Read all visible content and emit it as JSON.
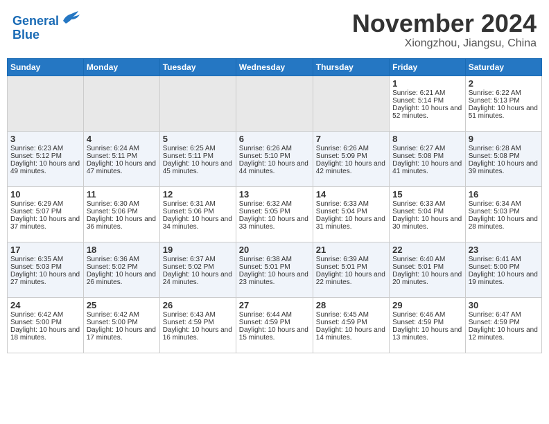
{
  "header": {
    "logo_line1": "General",
    "logo_line2": "Blue",
    "month_title": "November 2024",
    "location": "Xiongzhou, Jiangsu, China"
  },
  "weekdays": [
    "Sunday",
    "Monday",
    "Tuesday",
    "Wednesday",
    "Thursday",
    "Friday",
    "Saturday"
  ],
  "weeks": [
    [
      {
        "day": "",
        "sunrise": "",
        "sunset": "",
        "daylight": ""
      },
      {
        "day": "",
        "sunrise": "",
        "sunset": "",
        "daylight": ""
      },
      {
        "day": "",
        "sunrise": "",
        "sunset": "",
        "daylight": ""
      },
      {
        "day": "",
        "sunrise": "",
        "sunset": "",
        "daylight": ""
      },
      {
        "day": "",
        "sunrise": "",
        "sunset": "",
        "daylight": ""
      },
      {
        "day": "1",
        "sunrise": "Sunrise: 6:21 AM",
        "sunset": "Sunset: 5:14 PM",
        "daylight": "Daylight: 10 hours and 52 minutes."
      },
      {
        "day": "2",
        "sunrise": "Sunrise: 6:22 AM",
        "sunset": "Sunset: 5:13 PM",
        "daylight": "Daylight: 10 hours and 51 minutes."
      }
    ],
    [
      {
        "day": "3",
        "sunrise": "Sunrise: 6:23 AM",
        "sunset": "Sunset: 5:12 PM",
        "daylight": "Daylight: 10 hours and 49 minutes."
      },
      {
        "day": "4",
        "sunrise": "Sunrise: 6:24 AM",
        "sunset": "Sunset: 5:11 PM",
        "daylight": "Daylight: 10 hours and 47 minutes."
      },
      {
        "day": "5",
        "sunrise": "Sunrise: 6:25 AM",
        "sunset": "Sunset: 5:11 PM",
        "daylight": "Daylight: 10 hours and 45 minutes."
      },
      {
        "day": "6",
        "sunrise": "Sunrise: 6:26 AM",
        "sunset": "Sunset: 5:10 PM",
        "daylight": "Daylight: 10 hours and 44 minutes."
      },
      {
        "day": "7",
        "sunrise": "Sunrise: 6:26 AM",
        "sunset": "Sunset: 5:09 PM",
        "daylight": "Daylight: 10 hours and 42 minutes."
      },
      {
        "day": "8",
        "sunrise": "Sunrise: 6:27 AM",
        "sunset": "Sunset: 5:08 PM",
        "daylight": "Daylight: 10 hours and 41 minutes."
      },
      {
        "day": "9",
        "sunrise": "Sunrise: 6:28 AM",
        "sunset": "Sunset: 5:08 PM",
        "daylight": "Daylight: 10 hours and 39 minutes."
      }
    ],
    [
      {
        "day": "10",
        "sunrise": "Sunrise: 6:29 AM",
        "sunset": "Sunset: 5:07 PM",
        "daylight": "Daylight: 10 hours and 37 minutes."
      },
      {
        "day": "11",
        "sunrise": "Sunrise: 6:30 AM",
        "sunset": "Sunset: 5:06 PM",
        "daylight": "Daylight: 10 hours and 36 minutes."
      },
      {
        "day": "12",
        "sunrise": "Sunrise: 6:31 AM",
        "sunset": "Sunset: 5:06 PM",
        "daylight": "Daylight: 10 hours and 34 minutes."
      },
      {
        "day": "13",
        "sunrise": "Sunrise: 6:32 AM",
        "sunset": "Sunset: 5:05 PM",
        "daylight": "Daylight: 10 hours and 33 minutes."
      },
      {
        "day": "14",
        "sunrise": "Sunrise: 6:33 AM",
        "sunset": "Sunset: 5:04 PM",
        "daylight": "Daylight: 10 hours and 31 minutes."
      },
      {
        "day": "15",
        "sunrise": "Sunrise: 6:33 AM",
        "sunset": "Sunset: 5:04 PM",
        "daylight": "Daylight: 10 hours and 30 minutes."
      },
      {
        "day": "16",
        "sunrise": "Sunrise: 6:34 AM",
        "sunset": "Sunset: 5:03 PM",
        "daylight": "Daylight: 10 hours and 28 minutes."
      }
    ],
    [
      {
        "day": "17",
        "sunrise": "Sunrise: 6:35 AM",
        "sunset": "Sunset: 5:03 PM",
        "daylight": "Daylight: 10 hours and 27 minutes."
      },
      {
        "day": "18",
        "sunrise": "Sunrise: 6:36 AM",
        "sunset": "Sunset: 5:02 PM",
        "daylight": "Daylight: 10 hours and 26 minutes."
      },
      {
        "day": "19",
        "sunrise": "Sunrise: 6:37 AM",
        "sunset": "Sunset: 5:02 PM",
        "daylight": "Daylight: 10 hours and 24 minutes."
      },
      {
        "day": "20",
        "sunrise": "Sunrise: 6:38 AM",
        "sunset": "Sunset: 5:01 PM",
        "daylight": "Daylight: 10 hours and 23 minutes."
      },
      {
        "day": "21",
        "sunrise": "Sunrise: 6:39 AM",
        "sunset": "Sunset: 5:01 PM",
        "daylight": "Daylight: 10 hours and 22 minutes."
      },
      {
        "day": "22",
        "sunrise": "Sunrise: 6:40 AM",
        "sunset": "Sunset: 5:01 PM",
        "daylight": "Daylight: 10 hours and 20 minutes."
      },
      {
        "day": "23",
        "sunrise": "Sunrise: 6:41 AM",
        "sunset": "Sunset: 5:00 PM",
        "daylight": "Daylight: 10 hours and 19 minutes."
      }
    ],
    [
      {
        "day": "24",
        "sunrise": "Sunrise: 6:42 AM",
        "sunset": "Sunset: 5:00 PM",
        "daylight": "Daylight: 10 hours and 18 minutes."
      },
      {
        "day": "25",
        "sunrise": "Sunrise: 6:42 AM",
        "sunset": "Sunset: 5:00 PM",
        "daylight": "Daylight: 10 hours and 17 minutes."
      },
      {
        "day": "26",
        "sunrise": "Sunrise: 6:43 AM",
        "sunset": "Sunset: 4:59 PM",
        "daylight": "Daylight: 10 hours and 16 minutes."
      },
      {
        "day": "27",
        "sunrise": "Sunrise: 6:44 AM",
        "sunset": "Sunset: 4:59 PM",
        "daylight": "Daylight: 10 hours and 15 minutes."
      },
      {
        "day": "28",
        "sunrise": "Sunrise: 6:45 AM",
        "sunset": "Sunset: 4:59 PM",
        "daylight": "Daylight: 10 hours and 14 minutes."
      },
      {
        "day": "29",
        "sunrise": "Sunrise: 6:46 AM",
        "sunset": "Sunset: 4:59 PM",
        "daylight": "Daylight: 10 hours and 13 minutes."
      },
      {
        "day": "30",
        "sunrise": "Sunrise: 6:47 AM",
        "sunset": "Sunset: 4:59 PM",
        "daylight": "Daylight: 10 hours and 12 minutes."
      }
    ]
  ]
}
